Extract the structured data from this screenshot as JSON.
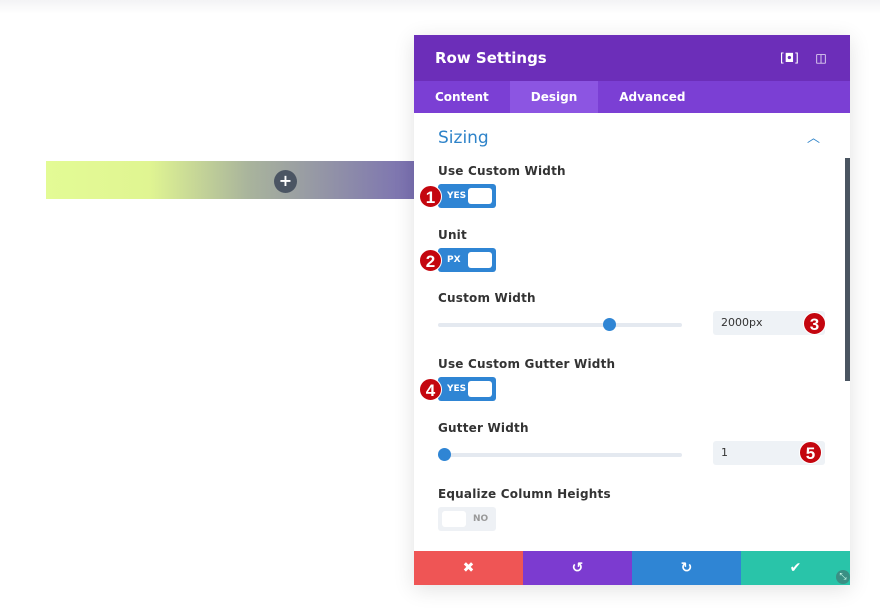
{
  "canvas": {
    "add_icon": "plus-icon"
  },
  "panel": {
    "title": "Row Settings",
    "header_icons": [
      "focus-icon",
      "split-view-icon"
    ],
    "tabs": [
      {
        "label": "Content"
      },
      {
        "label": "Design",
        "active": true
      },
      {
        "label": "Advanced"
      }
    ],
    "section": {
      "title": "Sizing",
      "expanded": true
    },
    "fields": {
      "use_custom_width": {
        "label": "Use Custom Width",
        "value": "YES"
      },
      "unit": {
        "label": "Unit",
        "value": "PX"
      },
      "custom_width": {
        "label": "Custom Width",
        "value": "2000px",
        "slider_percent": 70
      },
      "use_custom_gutter": {
        "label": "Use Custom Gutter Width",
        "value": "YES"
      },
      "gutter_width": {
        "label": "Gutter Width",
        "value": "1",
        "slider_percent": 0
      },
      "equalize": {
        "label": "Equalize Column Heights",
        "value": "NO"
      }
    },
    "footer": {
      "cancel": "✖",
      "undo": "↺",
      "redo": "↻",
      "save": "✔",
      "colors": {
        "cancel": "#ef5555",
        "undo": "#7c3bd0",
        "redo": "#2f85d4",
        "save": "#29c4a9"
      }
    }
  },
  "badges": [
    "1",
    "2",
    "3",
    "4",
    "5"
  ]
}
